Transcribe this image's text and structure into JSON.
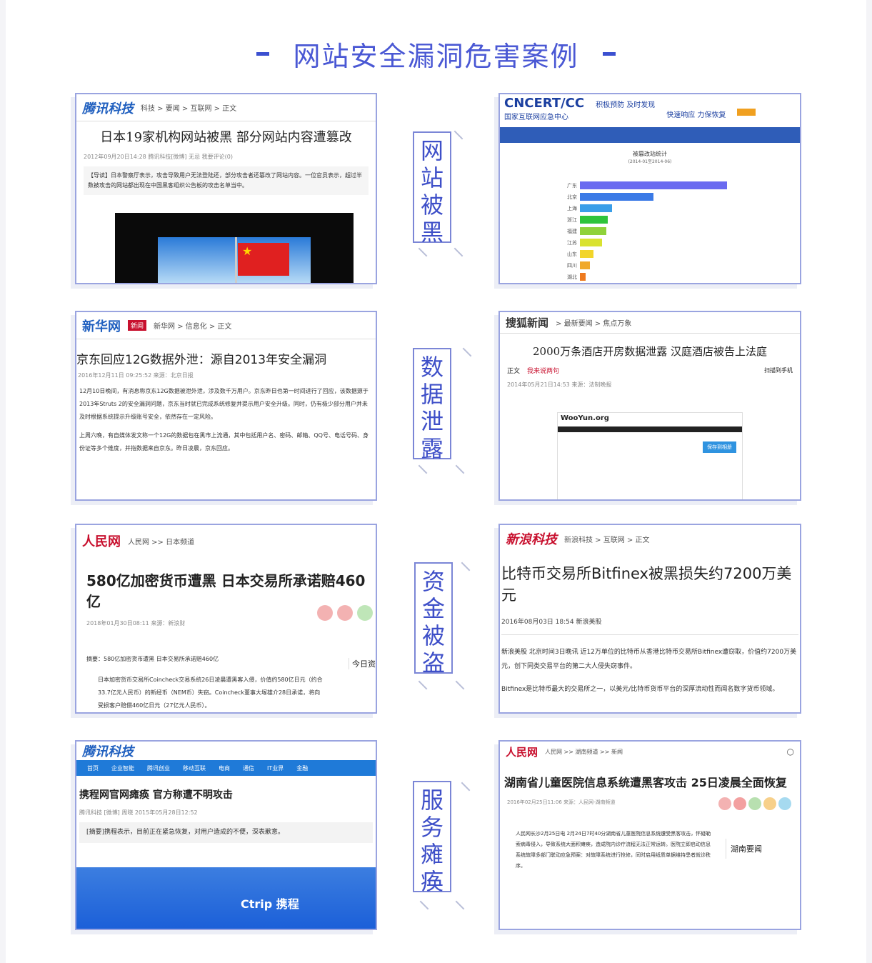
{
  "title": "网站安全漏洞危害案例",
  "categories": [
    {
      "label": [
        "网",
        "站",
        "被",
        "黑"
      ]
    },
    {
      "label": [
        "数",
        "据",
        "泄",
        "露"
      ]
    },
    {
      "label": [
        "资",
        "金",
        "被",
        "盗"
      ]
    },
    {
      "label": [
        "服",
        "务",
        "瘫",
        "痪"
      ]
    }
  ],
  "cards": {
    "c1": {
      "logo": "腾讯科技",
      "crumb": "科技 > 要闻 > 互联网 > 正文",
      "headline": "日本19家机构网站被黑 部分网站内容遭篡改",
      "meta": "2012年09月20日14:28  腾讯科技[微博]  无忌  我要评论(0)",
      "body": "【导读】日本警察厅表示，攻击导致用户无法登陆还，部分攻击者还篡改了网站内容。一位官员表示，超过半数被攻击的网站都出现在中国黑客组织公告板的攻击名单当中。"
    },
    "c2": {
      "logo": "CNCERT/CC",
      "sub": "国家互联网应急中心",
      "slogan1": "积极预防 及时发现",
      "slogan2": "快速响应 力保恢复",
      "chart_title": "被篡改站统计",
      "chart_sub": "(2014-01至2014-06)"
    },
    "c3": {
      "logo": "新华网",
      "tag": "新闻",
      "crumb": "新华网 > 信息化 > 正文",
      "headline": "京东回应12G数据外泄：源自2013年安全漏洞",
      "meta": "2016年12月11日 09:25:52  来源：北京日报",
      "body1": "12月10日晚间，有消息称京东12G数据被泄外泄，涉及数千万用户。京东昨日也第一时间进行了回应，该数据源于2013年Struts 2的安全漏洞问题，京东当时就已完成系统修复并提示用户安全升级。同时，仍有极少部分用户并未及时根据系统提示升级账号安全，依然存在一定风险。",
      "body2": "上周六晚，有自媒体发文称一个12G的数据包在黑市上流通，其中包括用户名、密码、邮箱、QQ号、电话号码、身份证等多个维度，并指数据来自京东。昨日凌晨，京东回应。"
    },
    "c4": {
      "logo": "搜狐新闻",
      "crumb": "> 最新要闻 > 焦点万象",
      "headline": "2000万条酒店开房数据泄露 汉庭酒店被告上法庭",
      "tab1": "正文",
      "tab2": "我来说两句",
      "share": "扫描到手机",
      "meta": "2014年05月21日14:53  来源：法制晚报",
      "site": "WooYun.org",
      "save": "保存到相册"
    },
    "c5": {
      "logo": "人民网",
      "crumb": "人民网 >> 日本频道",
      "headline": "580亿加密货币遭黑 日本交易所承诺赔460亿",
      "meta": "2018年01月30日08:11  来源：新浪财",
      "summary": "摘要：580亿加密货币遭黑 日本交易所承诺赔460亿",
      "body": "日本加密货币交易所Coincheck交易系统26日凌晨遭黑客入侵，价值约580亿日元（约合33.7亿元人民币）的新经币（NEM币）失窃。Coincheck董事大塚雄介28日承诺，将向受损客户赔偿460亿日元（27亿元人民币）。",
      "side": "今日资"
    },
    "c6": {
      "logo": "新浪科技",
      "crumb": "新浪科技 > 互联网 > 正文",
      "headline": "比特币交易所Bitfinex被黑损失约7200万美元",
      "meta": "2016年08月03日 18:54  新浪美股",
      "body1": "新浪美股 北京时间3日晚讯 近12万单位的比特币从香港比特币交易所Bitfinex遭窃取，价值约7200万美元，创下同类交易平台的第二大人侵失窃事件。",
      "body2": "Bitfinex是比特币最大的交易所之一，以美元/比特币货币平台的深厚流动性而闻名数字货币领域。"
    },
    "c7": {
      "logo": "腾讯科技",
      "menu": [
        "首页",
        "企业智能",
        "腾讯创业",
        "移动互联",
        "电商",
        "通信",
        "IT业界",
        "金融"
      ],
      "headline": "携程网官网瘫痪 官方称遭不明攻击",
      "meta": "腾讯科技  [微博]  周晓  2015年05月28日12:52",
      "summary": "[摘要]携程表示，目前正在紧急恢复，对用户造成的不便，深表歉意。",
      "brand": "Ctrip",
      "brand_cn": "携程"
    },
    "c8": {
      "logo": "人民网",
      "crumb": "人民网 >> 湖南频道 >> 新闻",
      "headline": "湖南省儿童医院信息系统遭黑客攻击 25日凌晨全面恢复",
      "meta": "2016年02月25日11:06  来源：人民网-湖南频道",
      "body": "人民网长沙2月25日电 2月24日7时40分湖南省儿童医院信息系统遭受黑客攻击，怀疑勒索病毒侵入，导致系统大面积瘫痪，造成院内诊疗流程无法正常运转。医院立即启动信息系统故障多部门联动应急预案：对故障系统进行抢修，同时启用纸质单据维持患者就诊秩序。",
      "side": "湖南要闻"
    }
  },
  "chart_data": {
    "type": "bar",
    "title": "被篡改站统计",
    "categories": [
      "广东",
      "北京",
      "上海",
      "浙江",
      "福建",
      "江苏",
      "山东",
      "四川",
      "湖北"
    ],
    "values": [
      100,
      50,
      22,
      19,
      18,
      15,
      9,
      7,
      4
    ],
    "colors": [
      "#6a6af0",
      "#3b7ae6",
      "#3a9ee8",
      "#2ec43b",
      "#8fd23a",
      "#d9e231",
      "#f2d52a",
      "#f0a92a",
      "#ee7a1f"
    ]
  },
  "colors": {
    "accent": "#4a58d4",
    "border": "#9aa4e0"
  }
}
